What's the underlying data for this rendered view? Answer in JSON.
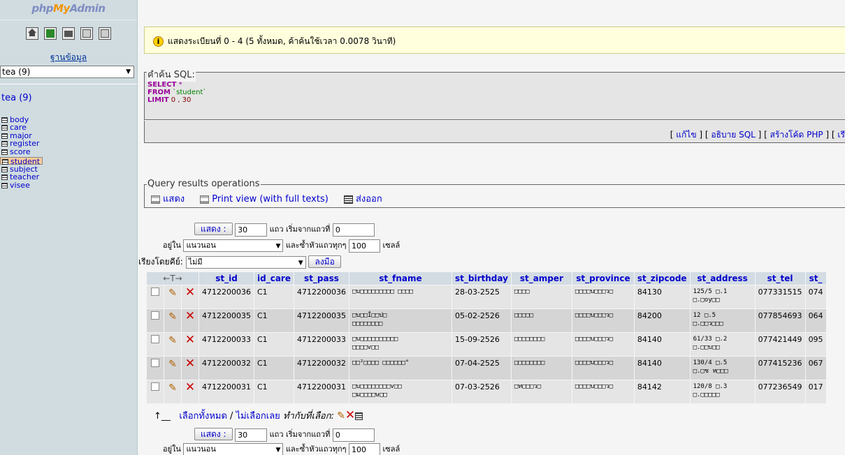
{
  "logo": {
    "p1": "php",
    "p2": "My",
    "p3": "Admin"
  },
  "left": {
    "db_label": "ฐานข้อมูล",
    "db_select": "tea (9)",
    "db_name": "tea (9)",
    "tables": [
      {
        "name": "body",
        "selected": false
      },
      {
        "name": "care",
        "selected": false
      },
      {
        "name": "major",
        "selected": false
      },
      {
        "name": "register",
        "selected": false
      },
      {
        "name": "score",
        "selected": false
      },
      {
        "name": "student",
        "selected": true
      },
      {
        "name": "subject",
        "selected": false
      },
      {
        "name": "teacher",
        "selected": false
      },
      {
        "name": "visee",
        "selected": false
      }
    ]
  },
  "notice": "แสดงระเบียนที่ 0 - 4 (5 ทั้งหมด, ค้าค้นใช้เวลา 0.0078 วินาที)",
  "sql": {
    "legend": "คำค้น SQL:",
    "select_kw": "SELECT",
    "star": "*",
    "from_kw": "FROM",
    "table": "`student`",
    "limit_kw": "LIMIT",
    "limit_val": "0 , 30"
  },
  "sql_links": {
    "edit": "แก้ไข",
    "explain": "อธิบาย SQL",
    "php": "สร้างโค้ด PHP",
    "refresh": "เรีย"
  },
  "qro": {
    "legend": "Query results operations",
    "show": "แสดง",
    "print": "Print view (with full texts)",
    "export": "ส่งออก"
  },
  "nav": {
    "show_btn": "แสดง :",
    "rows": "30",
    "rows_label": "แถว เริ่มจากแถวที่",
    "start": "0",
    "in_label": "อยู่ใน",
    "mode": "แนวนอน",
    "repeat_label": "และซ้ำหัวแถวทุกๆ",
    "repeat": "100",
    "cells": "เซลล์",
    "sort_label": "เรียงโดยคีย์:",
    "sort_value": "ไม่มี",
    "go": "ลงมือ"
  },
  "table": {
    "headers": [
      "st_id",
      "id_care",
      "st_pass",
      "st_fname",
      "st_birthday",
      "st_amper",
      "st_province",
      "st_zipcode",
      "st_address",
      "st_tel",
      "st_"
    ],
    "rows": [
      [
        "4712200036",
        "C1",
        "4712200036",
        "□บ□□□□□□□□□ □□□□",
        "28-03-2525",
        "□□□□",
        "□□□□บ□□□ว□",
        "84130",
        "125/5 □.1\n□.□oy□□",
        "077331515",
        "074"
      ],
      [
        "4712200035",
        "C1",
        "4712200035",
        "□บ□□Î□□ป□\n□□□□□□□□",
        "05-02-2526",
        "□□□□□",
        "□□□□บ□□□ว□",
        "84200",
        "12 □.5\n□.□□ว□□□",
        "077854693",
        "064"
      ],
      [
        "4712200033",
        "C1",
        "4712200033",
        "□บ□□□□□□□□□□\n□□□□v□□",
        "15-09-2526",
        "□□□□□□□□",
        "□□□□บ□□□ว□",
        "84140",
        "61/33 □.2\n□.□□บ□□",
        "077421449",
        "095"
      ],
      [
        "4712200032",
        "C1",
        "4712200032",
        "□□²□□□□ □□□□□□°",
        "07-04-2525",
        "□□□□□□□□",
        "□□□□บ□□□ว□",
        "84140",
        "130/4 □.5\n□.□ช ห□□□",
        "077415236",
        "067"
      ],
      [
        "4712200031",
        "C1",
        "4712200031",
        "□บ□□□□□□□□v□□\n□ม□□□□ษ□□",
        "07-03-2526",
        "□ท□□□ว□",
        "□□□□บ□□□ว□",
        "84142",
        "120/8 □.3\n□.□□□□□",
        "077236549",
        "017"
      ]
    ]
  },
  "check_all": {
    "all": "เลือกทั้งหมด",
    "sep": " / ",
    "none": "ไม่เลือกเลย",
    "with": "ทำกับที่เลือก:"
  },
  "colors": {
    "left_bg": "#d0dce0",
    "header_bg": "#d3dce3",
    "row_odd": "#e5e5e5",
    "row_even": "#d5d5d5",
    "selected_table": "#ffcc99",
    "notice_bg": "#ffffdd"
  }
}
